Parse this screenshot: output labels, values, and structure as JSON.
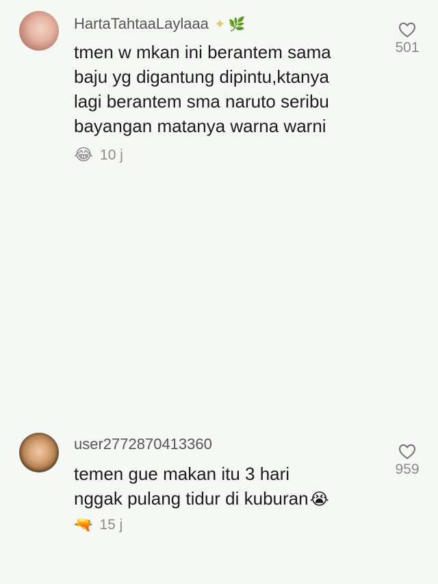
{
  "comments": [
    {
      "username": "HartaTahtaaLaylaaa",
      "username_decoration": "✦",
      "username_decoration_2": "🌿",
      "lines": [
        "tmen w mkan ini berantem sama",
        "baju yg digantung dipintu,ktanya",
        "lagi berantem sma naruto seribu",
        "bayangan matanya warna warni"
      ],
      "reaction_emoji": "😂",
      "time": "10 j",
      "likes": "501"
    },
    {
      "username": "user2772870413360",
      "lines": [
        "temen gue makan itu 3 hari",
        "nggak pulang tidur di kuburan"
      ],
      "inline_emoji": "😭",
      "reaction_emoji": "🔫",
      "time": "15 j",
      "likes": "959"
    }
  ],
  "icons": {
    "like": "heart-outline-icon"
  }
}
